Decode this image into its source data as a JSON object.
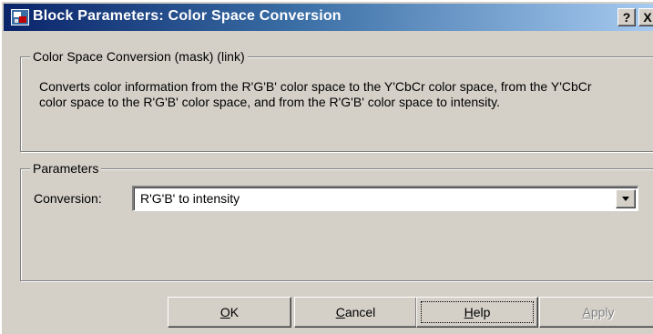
{
  "window": {
    "title": "Block Parameters: Color Space  Conversion",
    "help_glyph": "?",
    "close_glyph": "X",
    "title_icon": "simulink-block-icon"
  },
  "description": {
    "legend": "Color Space Conversion (mask) (link)",
    "text": "Converts color information from the R'G'B' color space to the Y'CbCr color space, from the Y'CbCr color space to the R'G'B' color space, and from the R'G'B' color space to intensity."
  },
  "parameters": {
    "legend": "Parameters",
    "conversion_label": "Conversion:",
    "conversion_value": "R'G'B' to intensity"
  },
  "buttons": {
    "ok": {
      "mnemonic": "O",
      "rest": "K"
    },
    "cancel": {
      "mnemonic": "C",
      "rest": "ancel"
    },
    "help": {
      "mnemonic": "H",
      "rest": "elp"
    },
    "apply": {
      "mnemonic": "A",
      "rest": "pply"
    }
  },
  "colors": {
    "titlebar_start": "#0a246a",
    "titlebar_end": "#a6caf0",
    "face": "#d4d0c8",
    "disabled_text": "#808080"
  }
}
